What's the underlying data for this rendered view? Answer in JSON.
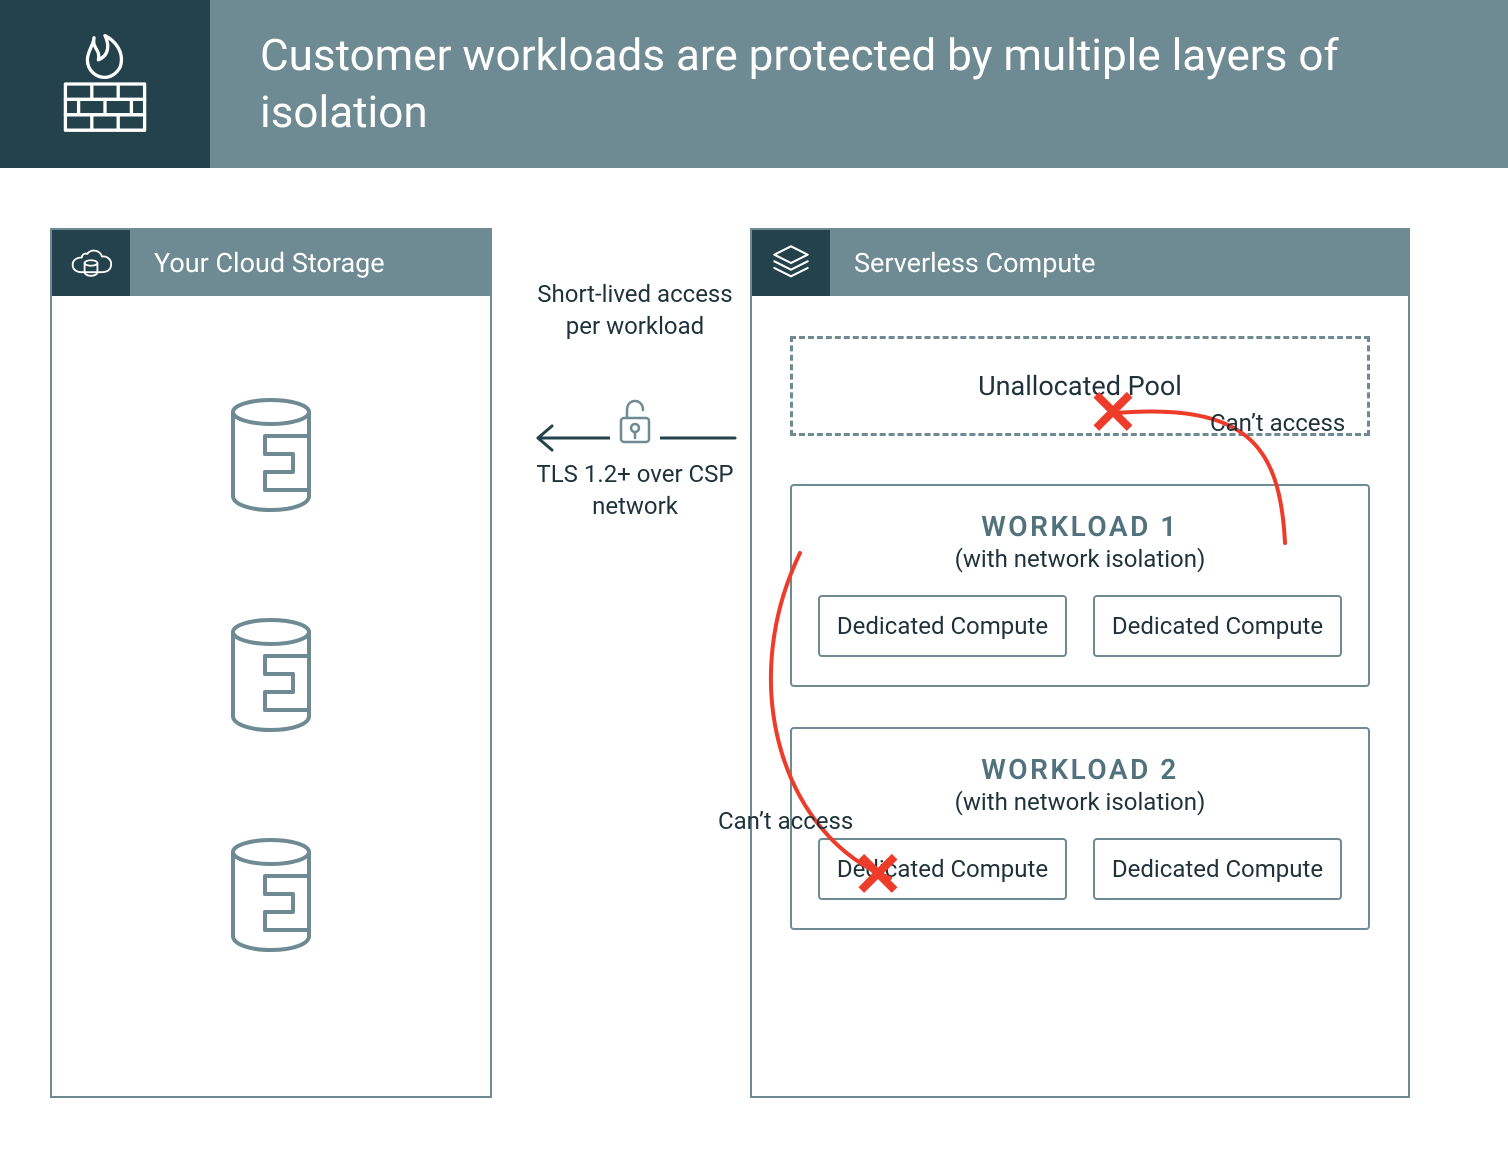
{
  "header": {
    "title": "Customer workloads are protected by multiple layers of isolation"
  },
  "storage": {
    "title": "Your Cloud Storage"
  },
  "compute": {
    "title": "Serverless Compute",
    "pool": "Unallocated Pool",
    "workload1": {
      "title": "WORKLOAD 1",
      "subtitle": "(with network isolation)",
      "box1": "Dedicated Compute",
      "box2": "Dedicated Compute"
    },
    "workload2": {
      "title": "WORKLOAD 2",
      "subtitle": "(with network isolation)",
      "box1": "Dedicated Compute",
      "box2": "Dedicated Compute"
    }
  },
  "connection": {
    "top": "Short-lived access per workload",
    "bottom": "TLS 1.2+ over CSP network"
  },
  "deny": {
    "label1": "Can’t access",
    "label2": "Can’t access"
  }
}
